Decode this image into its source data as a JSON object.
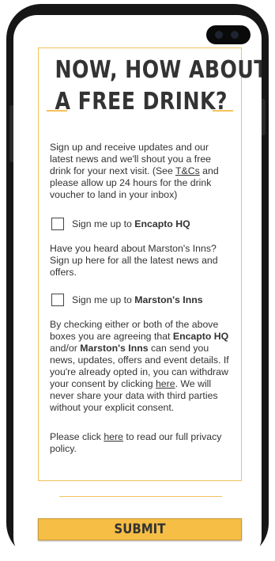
{
  "header": {
    "title_line1": "NOW, HOW ABOUT",
    "title_line2": "A FREE DRINK?"
  },
  "intro": {
    "text_before_link": "Sign up and receive updates and our latest news and we'll shout you a free drink for your next visit. (See ",
    "link_label": "T&Cs",
    "text_after_link": " and please allow up 24 hours for the drink voucher to land in your inbox)"
  },
  "checkbox_encapto": {
    "label_prefix": "Sign me up to ",
    "brand": "Encapto HQ",
    "checked": false
  },
  "marstons_intro": "Have you heard about Marston's Inns? Sign up here for all the latest news and offers.",
  "checkbox_marstons": {
    "label_prefix": "Sign me up to ",
    "brand": "Marston's Inns",
    "checked": false
  },
  "consent": {
    "part1": "By checking either or both of the above boxes you are agreeing that ",
    "brand1": "Encapto HQ",
    "part2": " and/or ",
    "brand2": "Marston's Inns",
    "part3": " can send you news, updates, offers and event details. If you're already opted in, you can withdraw your consent by clicking ",
    "link_label": "here",
    "part4": ". We will never share your data with third parties without your explicit consent."
  },
  "privacy": {
    "before": "Please click ",
    "link_label": "here",
    "after": " to read our full privacy policy."
  },
  "submit_label": "SUBMIT",
  "colors": {
    "accent": "#f2c25c",
    "button": "#f6be45",
    "text": "#333333",
    "phone_frame": "#161616"
  }
}
